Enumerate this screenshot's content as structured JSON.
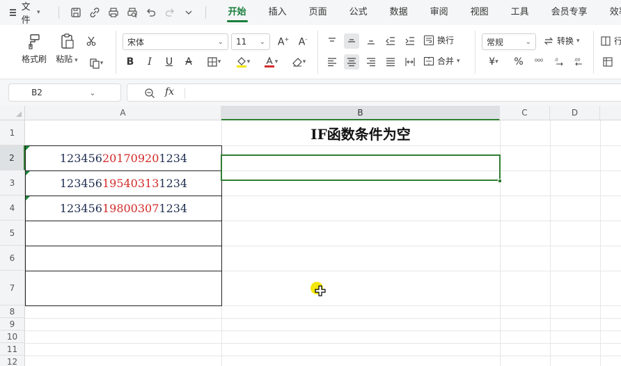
{
  "menubar": {
    "file_label": "文件",
    "tabs": [
      {
        "label": "开始",
        "active": true
      },
      {
        "label": "插入",
        "active": false
      },
      {
        "label": "页面",
        "active": false
      },
      {
        "label": "公式",
        "active": false
      },
      {
        "label": "数据",
        "active": false
      },
      {
        "label": "审阅",
        "active": false
      },
      {
        "label": "视图",
        "active": false
      },
      {
        "label": "工具",
        "active": false
      },
      {
        "label": "会员专享",
        "active": false
      },
      {
        "label": "效率",
        "active": false
      }
    ],
    "accent": "#1a7f3c"
  },
  "ribbon": {
    "format_painter": "格式刷",
    "paste": "粘贴",
    "font_name": "宋体",
    "font_size": "11",
    "wrap_text": "换行",
    "merge": "合并",
    "number_format": "常规",
    "convert": "转换",
    "row_col_partial": "行"
  },
  "formula_bar": {
    "name_box": "B2",
    "fx": "fx",
    "formula": ""
  },
  "sheet": {
    "columns": [
      "A",
      "B",
      "C",
      "D"
    ],
    "rows": [
      "1",
      "2",
      "3",
      "4",
      "5",
      "6",
      "7",
      "8",
      "9",
      "10",
      "11",
      "12"
    ],
    "title": "IF函数条件为空",
    "a_cells": [
      {
        "prefix": "123456",
        "date": "20170920",
        "suffix": "1234"
      },
      {
        "prefix": "123456",
        "date": "19540313",
        "suffix": "1234"
      },
      {
        "prefix": "123456",
        "date": "19800307",
        "suffix": "1234"
      }
    ],
    "selected_cell": "B2",
    "selection_color": "#2f7d32"
  }
}
